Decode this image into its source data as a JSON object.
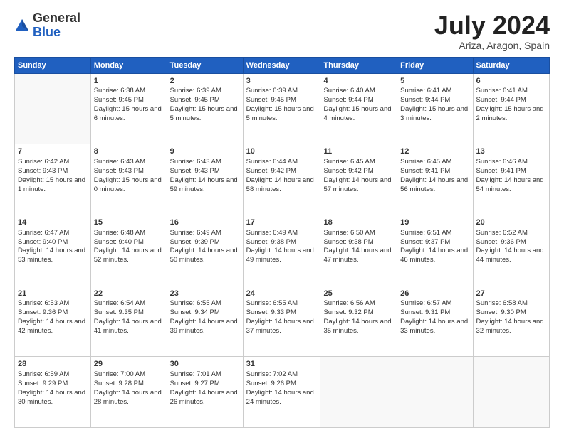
{
  "header": {
    "logo_general": "General",
    "logo_blue": "Blue",
    "month_year": "July 2024",
    "location": "Ariza, Aragon, Spain"
  },
  "days_of_week": [
    "Sunday",
    "Monday",
    "Tuesday",
    "Wednesday",
    "Thursday",
    "Friday",
    "Saturday"
  ],
  "weeks": [
    [
      {
        "day": "",
        "sunrise": "",
        "sunset": "",
        "daylight": ""
      },
      {
        "day": "1",
        "sunrise": "Sunrise: 6:38 AM",
        "sunset": "Sunset: 9:45 PM",
        "daylight": "Daylight: 15 hours and 6 minutes."
      },
      {
        "day": "2",
        "sunrise": "Sunrise: 6:39 AM",
        "sunset": "Sunset: 9:45 PM",
        "daylight": "Daylight: 15 hours and 5 minutes."
      },
      {
        "day": "3",
        "sunrise": "Sunrise: 6:39 AM",
        "sunset": "Sunset: 9:45 PM",
        "daylight": "Daylight: 15 hours and 5 minutes."
      },
      {
        "day": "4",
        "sunrise": "Sunrise: 6:40 AM",
        "sunset": "Sunset: 9:44 PM",
        "daylight": "Daylight: 15 hours and 4 minutes."
      },
      {
        "day": "5",
        "sunrise": "Sunrise: 6:41 AM",
        "sunset": "Sunset: 9:44 PM",
        "daylight": "Daylight: 15 hours and 3 minutes."
      },
      {
        "day": "6",
        "sunrise": "Sunrise: 6:41 AM",
        "sunset": "Sunset: 9:44 PM",
        "daylight": "Daylight: 15 hours and 2 minutes."
      }
    ],
    [
      {
        "day": "7",
        "sunrise": "Sunrise: 6:42 AM",
        "sunset": "Sunset: 9:43 PM",
        "daylight": "Daylight: 15 hours and 1 minute."
      },
      {
        "day": "8",
        "sunrise": "Sunrise: 6:43 AM",
        "sunset": "Sunset: 9:43 PM",
        "daylight": "Daylight: 15 hours and 0 minutes."
      },
      {
        "day": "9",
        "sunrise": "Sunrise: 6:43 AM",
        "sunset": "Sunset: 9:43 PM",
        "daylight": "Daylight: 14 hours and 59 minutes."
      },
      {
        "day": "10",
        "sunrise": "Sunrise: 6:44 AM",
        "sunset": "Sunset: 9:42 PM",
        "daylight": "Daylight: 14 hours and 58 minutes."
      },
      {
        "day": "11",
        "sunrise": "Sunrise: 6:45 AM",
        "sunset": "Sunset: 9:42 PM",
        "daylight": "Daylight: 14 hours and 57 minutes."
      },
      {
        "day": "12",
        "sunrise": "Sunrise: 6:45 AM",
        "sunset": "Sunset: 9:41 PM",
        "daylight": "Daylight: 14 hours and 56 minutes."
      },
      {
        "day": "13",
        "sunrise": "Sunrise: 6:46 AM",
        "sunset": "Sunset: 9:41 PM",
        "daylight": "Daylight: 14 hours and 54 minutes."
      }
    ],
    [
      {
        "day": "14",
        "sunrise": "Sunrise: 6:47 AM",
        "sunset": "Sunset: 9:40 PM",
        "daylight": "Daylight: 14 hours and 53 minutes."
      },
      {
        "day": "15",
        "sunrise": "Sunrise: 6:48 AM",
        "sunset": "Sunset: 9:40 PM",
        "daylight": "Daylight: 14 hours and 52 minutes."
      },
      {
        "day": "16",
        "sunrise": "Sunrise: 6:49 AM",
        "sunset": "Sunset: 9:39 PM",
        "daylight": "Daylight: 14 hours and 50 minutes."
      },
      {
        "day": "17",
        "sunrise": "Sunrise: 6:49 AM",
        "sunset": "Sunset: 9:38 PM",
        "daylight": "Daylight: 14 hours and 49 minutes."
      },
      {
        "day": "18",
        "sunrise": "Sunrise: 6:50 AM",
        "sunset": "Sunset: 9:38 PM",
        "daylight": "Daylight: 14 hours and 47 minutes."
      },
      {
        "day": "19",
        "sunrise": "Sunrise: 6:51 AM",
        "sunset": "Sunset: 9:37 PM",
        "daylight": "Daylight: 14 hours and 46 minutes."
      },
      {
        "day": "20",
        "sunrise": "Sunrise: 6:52 AM",
        "sunset": "Sunset: 9:36 PM",
        "daylight": "Daylight: 14 hours and 44 minutes."
      }
    ],
    [
      {
        "day": "21",
        "sunrise": "Sunrise: 6:53 AM",
        "sunset": "Sunset: 9:36 PM",
        "daylight": "Daylight: 14 hours and 42 minutes."
      },
      {
        "day": "22",
        "sunrise": "Sunrise: 6:54 AM",
        "sunset": "Sunset: 9:35 PM",
        "daylight": "Daylight: 14 hours and 41 minutes."
      },
      {
        "day": "23",
        "sunrise": "Sunrise: 6:55 AM",
        "sunset": "Sunset: 9:34 PM",
        "daylight": "Daylight: 14 hours and 39 minutes."
      },
      {
        "day": "24",
        "sunrise": "Sunrise: 6:55 AM",
        "sunset": "Sunset: 9:33 PM",
        "daylight": "Daylight: 14 hours and 37 minutes."
      },
      {
        "day": "25",
        "sunrise": "Sunrise: 6:56 AM",
        "sunset": "Sunset: 9:32 PM",
        "daylight": "Daylight: 14 hours and 35 minutes."
      },
      {
        "day": "26",
        "sunrise": "Sunrise: 6:57 AM",
        "sunset": "Sunset: 9:31 PM",
        "daylight": "Daylight: 14 hours and 33 minutes."
      },
      {
        "day": "27",
        "sunrise": "Sunrise: 6:58 AM",
        "sunset": "Sunset: 9:30 PM",
        "daylight": "Daylight: 14 hours and 32 minutes."
      }
    ],
    [
      {
        "day": "28",
        "sunrise": "Sunrise: 6:59 AM",
        "sunset": "Sunset: 9:29 PM",
        "daylight": "Daylight: 14 hours and 30 minutes."
      },
      {
        "day": "29",
        "sunrise": "Sunrise: 7:00 AM",
        "sunset": "Sunset: 9:28 PM",
        "daylight": "Daylight: 14 hours and 28 minutes."
      },
      {
        "day": "30",
        "sunrise": "Sunrise: 7:01 AM",
        "sunset": "Sunset: 9:27 PM",
        "daylight": "Daylight: 14 hours and 26 minutes."
      },
      {
        "day": "31",
        "sunrise": "Sunrise: 7:02 AM",
        "sunset": "Sunset: 9:26 PM",
        "daylight": "Daylight: 14 hours and 24 minutes."
      },
      {
        "day": "",
        "sunrise": "",
        "sunset": "",
        "daylight": ""
      },
      {
        "day": "",
        "sunrise": "",
        "sunset": "",
        "daylight": ""
      },
      {
        "day": "",
        "sunrise": "",
        "sunset": "",
        "daylight": ""
      }
    ]
  ]
}
